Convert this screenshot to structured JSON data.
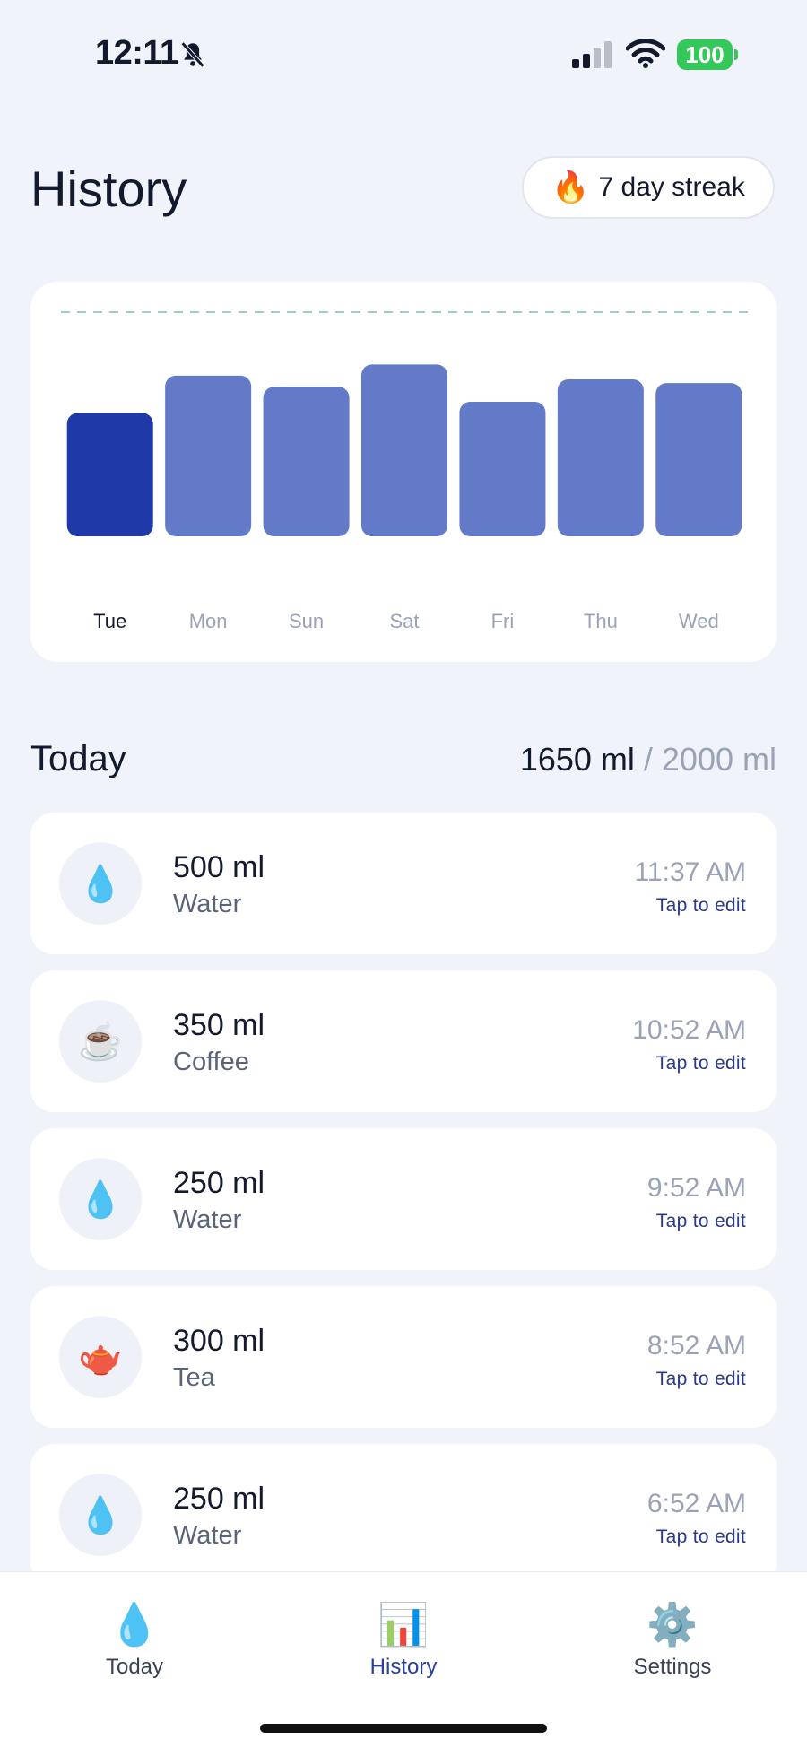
{
  "status_bar": {
    "time": "12:11",
    "battery": "100",
    "icons": [
      "bell-slash-icon",
      "cellular-signal-icon",
      "wifi-icon",
      "battery-icon"
    ]
  },
  "header": {
    "title": "History",
    "streak": {
      "icon": "flame-icon",
      "label": "7 day streak"
    }
  },
  "chart_data": {
    "type": "bar",
    "categories": [
      "Tue",
      "Mon",
      "Sun",
      "Sat",
      "Fri",
      "Thu",
      "Wed"
    ],
    "values": [
      1650,
      2150,
      2000,
      2300,
      1800,
      2100,
      2050
    ],
    "goal": 2000,
    "highlighted_category": "Tue",
    "title": "",
    "xlabel": "",
    "ylabel": "",
    "ylim": [
      0,
      3000
    ],
    "grid": false,
    "goal_line": "dashed",
    "colors": {
      "highlight": "#1f3aa8",
      "bar": "#637ac9",
      "goal_line": "#9fcfc4",
      "label_active": "#141a2e",
      "label": "#9aa3b5"
    }
  },
  "today": {
    "heading": "Today",
    "total": "1650 ml",
    "goal": " / 2000 ml",
    "entries": [
      {
        "icon": "water-drop-icon",
        "glyph": "💧",
        "amount": "500 ml",
        "type": "Water",
        "time": "11:37 AM",
        "edit": "Tap to edit"
      },
      {
        "icon": "coffee-icon",
        "glyph": "☕",
        "amount": "350 ml",
        "type": "Coffee",
        "time": "10:52 AM",
        "edit": "Tap to edit"
      },
      {
        "icon": "water-drop-icon",
        "glyph": "💧",
        "amount": "250 ml",
        "type": "Water",
        "time": "9:52 AM",
        "edit": "Tap to edit"
      },
      {
        "icon": "teapot-icon",
        "glyph": "🫖",
        "amount": "300 ml",
        "type": "Tea",
        "time": "8:52 AM",
        "edit": "Tap to edit"
      },
      {
        "icon": "water-drop-icon",
        "glyph": "💧",
        "amount": "250 ml",
        "type": "Water",
        "time": "6:52 AM",
        "edit": "Tap to edit"
      }
    ]
  },
  "tab_bar": {
    "active": "History",
    "tabs": [
      {
        "icon": "water-drop-icon",
        "glyph": "💧",
        "label": "Today"
      },
      {
        "icon": "bar-chart-icon",
        "glyph": "📊",
        "label": "History"
      },
      {
        "icon": "gear-icon",
        "glyph": "⚙️",
        "label": "Settings"
      }
    ]
  }
}
